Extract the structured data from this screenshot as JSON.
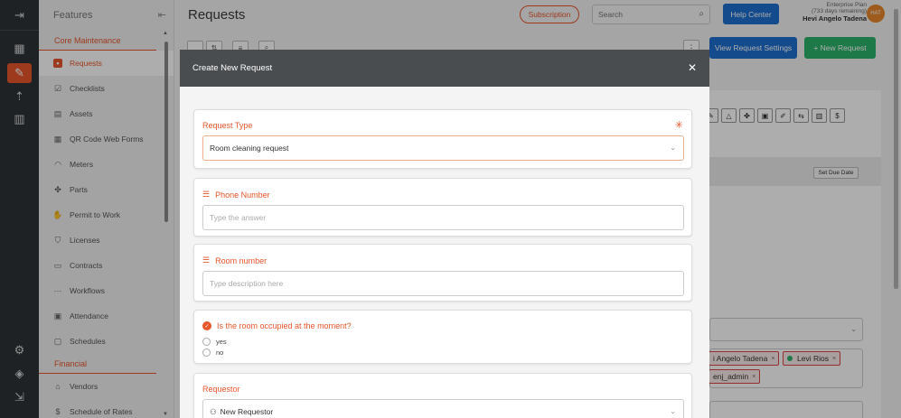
{
  "rail": {
    "icons": [
      "expand-icon",
      "dashboard-icon",
      "wrench-icon",
      "upload-icon",
      "analytics-icon",
      "settings-icon",
      "cube-icon",
      "logout-icon"
    ]
  },
  "sidebar": {
    "title": "Features",
    "section_core": "Core Maintenance",
    "items": [
      {
        "label": "Requests",
        "icon": "requests-icon"
      },
      {
        "label": "Checklists",
        "icon": "checklist-icon"
      },
      {
        "label": "Assets",
        "icon": "assets-icon"
      },
      {
        "label": "QR Code Web Forms",
        "icon": "qr-icon"
      },
      {
        "label": "Meters",
        "icon": "meter-icon"
      },
      {
        "label": "Parts",
        "icon": "parts-icon"
      },
      {
        "label": "Permit to Work",
        "icon": "permit-icon"
      },
      {
        "label": "Licenses",
        "icon": "license-icon"
      },
      {
        "label": "Contracts",
        "icon": "contract-icon"
      },
      {
        "label": "Workflows",
        "icon": "workflow-icon"
      },
      {
        "label": "Attendance",
        "icon": "attendance-icon"
      },
      {
        "label": "Schedules",
        "icon": "schedule-icon"
      }
    ],
    "section_financial": "Financial",
    "financial_items": [
      {
        "label": "Vendors",
        "icon": "vendor-icon"
      },
      {
        "label": "Schedule of Rates",
        "icon": "dollar-icon"
      }
    ]
  },
  "header": {
    "title": "Requests",
    "subscription_label": "Subscription",
    "search_placeholder": "Search",
    "help_label": "Help Center",
    "plan_line1": "Enterprise Plan",
    "plan_line2": "(733 days remaining)",
    "user_name": "Hevi Angelo Tadena",
    "avatar_initials": "HAT"
  },
  "background": {
    "view_settings_label": "View Request Settings",
    "new_request_label": "+ New Request",
    "set_due_date_label": "Set Due Date",
    "tags": [
      "i Angelo Tadena",
      "Levi Rios",
      "enj_admin"
    ]
  },
  "modal": {
    "title": "Create New Request",
    "request_type": {
      "label": "Request Type",
      "value": "Room cleaning request"
    },
    "phone": {
      "label": "Phone Number",
      "placeholder": "Type the answer"
    },
    "room": {
      "label": "Room number",
      "placeholder": "Type description here"
    },
    "occupied": {
      "label": "Is the room occupied at the moment?",
      "options": [
        "yes",
        "no"
      ]
    },
    "requestor": {
      "label": "Requestor",
      "value": "New Requestor"
    }
  },
  "colors": {
    "accent": "#e8562b",
    "primary_blue": "#1e6fd0",
    "success_green": "#2db36a",
    "rail_bg": "#2f3336",
    "modal_header": "#4a4d50"
  }
}
